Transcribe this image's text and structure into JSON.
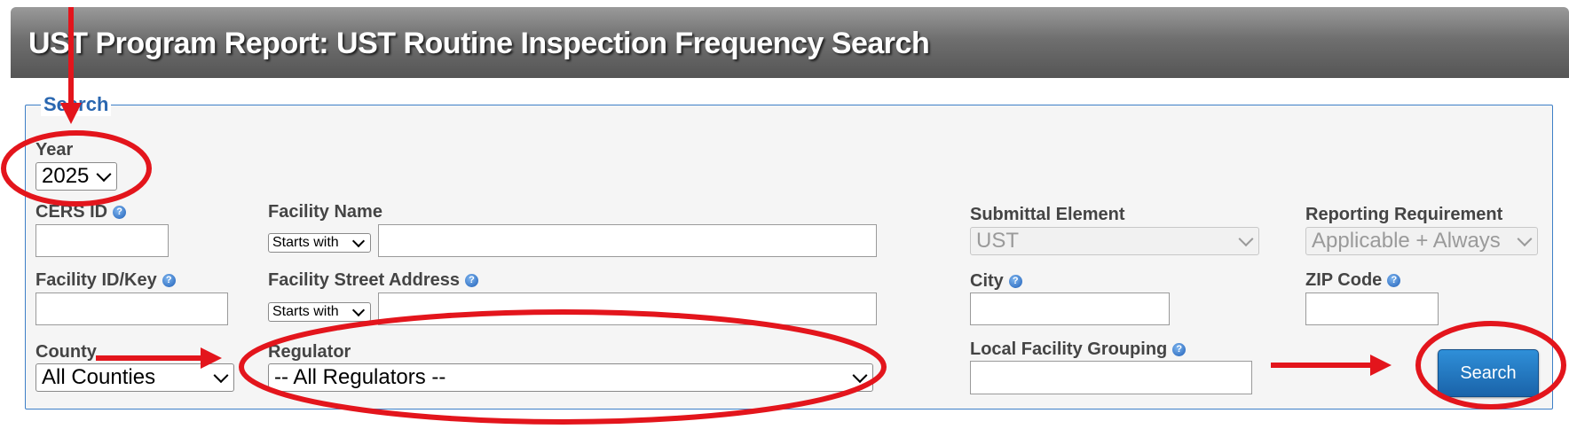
{
  "header": {
    "title": "UST Program Report: UST Routine Inspection Frequency Search"
  },
  "search": {
    "legend": "Search",
    "year": {
      "label": "Year",
      "value": "2025"
    },
    "cers_id": {
      "label": "CERS ID",
      "value": ""
    },
    "facility_name": {
      "label": "Facility Name",
      "match": "Starts with",
      "value": ""
    },
    "submittal_element": {
      "label": "Submittal Element",
      "value": "UST"
    },
    "reporting_requirement": {
      "label": "Reporting Requirement",
      "value": "Applicable + Always"
    },
    "facility_id": {
      "label": "Facility ID/Key",
      "value": ""
    },
    "facility_street": {
      "label": "Facility Street Address",
      "match": "Starts with",
      "value": ""
    },
    "city": {
      "label": "City",
      "value": ""
    },
    "zip": {
      "label": "ZIP Code",
      "value": ""
    },
    "county": {
      "label": "County",
      "value": "All Counties"
    },
    "regulator": {
      "label": "Regulator",
      "value": "-- All Regulators --"
    },
    "local_grouping": {
      "label": "Local Facility Grouping",
      "value": ""
    },
    "search_button": "Search"
  },
  "annotation_color": "#e3151c",
  "icons": [
    "help-icon",
    "chevron-down-icon"
  ]
}
